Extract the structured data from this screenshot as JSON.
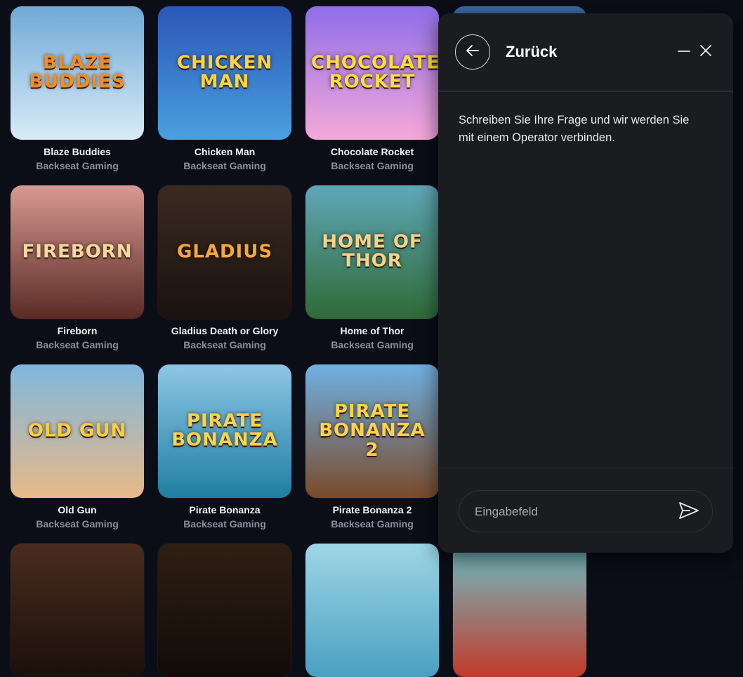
{
  "games": [
    {
      "name": "Blaze Buddies",
      "provider": "Backseat Gaming",
      "art_text": "BLAZE BUDDIES",
      "colors": {
        "bg1": "#6fa9d6",
        "bg2": "#d9ecf7",
        "text": "#ff8a1c"
      }
    },
    {
      "name": "Chicken Man",
      "provider": "Backseat Gaming",
      "art_text": "CHICKEN MAN",
      "colors": {
        "bg1": "#2b56b8",
        "bg2": "#4aa0e0",
        "text": "#ffd43a"
      }
    },
    {
      "name": "Chocolate Rocket",
      "provider": "Backseat Gaming",
      "art_text": "CHOCOLATE ROCKET",
      "colors": {
        "bg1": "#8f6ee8",
        "bg2": "#f5a8d8",
        "text": "#ffde3b"
      }
    },
    {
      "name": "Fireborn",
      "provider": "Backseat Gaming",
      "art_text": "FIREBORN",
      "colors": {
        "bg1": "#d79a92",
        "bg2": "#5a2a24",
        "text": "#f5d8a0"
      }
    },
    {
      "name": "Gladius Death or Glory",
      "provider": "Backseat Gaming",
      "art_text": "GLADIUS",
      "colors": {
        "bg1": "#3a2a22",
        "bg2": "#1a120e",
        "text": "#f2a83a"
      }
    },
    {
      "name": "Home of Thor",
      "provider": "Backseat Gaming",
      "art_text": "HOME OF THOR",
      "colors": {
        "bg1": "#5fa7b8",
        "bg2": "#2f6a36",
        "text": "#f3d58a"
      }
    },
    {
      "name": "Old Gun",
      "provider": "Backseat Gaming",
      "art_text": "OLD GUN",
      "colors": {
        "bg1": "#7fb7de",
        "bg2": "#e8b988",
        "text": "#ffcf3a"
      }
    },
    {
      "name": "Pirate Bonanza",
      "provider": "Backseat Gaming",
      "art_text": "PIRATE BONANZA",
      "colors": {
        "bg1": "#8ec6e6",
        "bg2": "#1f7fa2",
        "text": "#ffd34a"
      }
    },
    {
      "name": "Pirate Bonanza 2",
      "provider": "Backseat Gaming",
      "art_text": "PIRATE BONANZA 2",
      "colors": {
        "bg1": "#6fb1e4",
        "bg2": "#7a4a2a",
        "text": "#ffd34a"
      }
    }
  ],
  "partial_tiles": [
    {
      "colors": {
        "bg1": "#3b6fa8",
        "bg2": "#1a2f4a"
      }
    },
    {
      "colors": {
        "bg1": "#4a2c1e",
        "bg2": "#1a0f0b"
      }
    },
    {
      "colors": {
        "bg1": "#2e1f14",
        "bg2": "#120b07"
      }
    },
    {
      "colors": {
        "bg1": "#9fd6e6",
        "bg2": "#4aa0c0"
      }
    },
    {
      "colors": {
        "bg1": "#6ec1c8",
        "bg2": "#c23a2a"
      }
    }
  ],
  "chat": {
    "title": "Zurück",
    "message": "Schreiben Sie Ihre Frage und wir werden Sie mit einem Operator verbinden.",
    "input_placeholder": "Eingabefeld",
    "icons": {
      "back": "arrow-left-icon",
      "minimize": "minus-icon",
      "close": "close-icon",
      "send": "send-icon"
    }
  }
}
